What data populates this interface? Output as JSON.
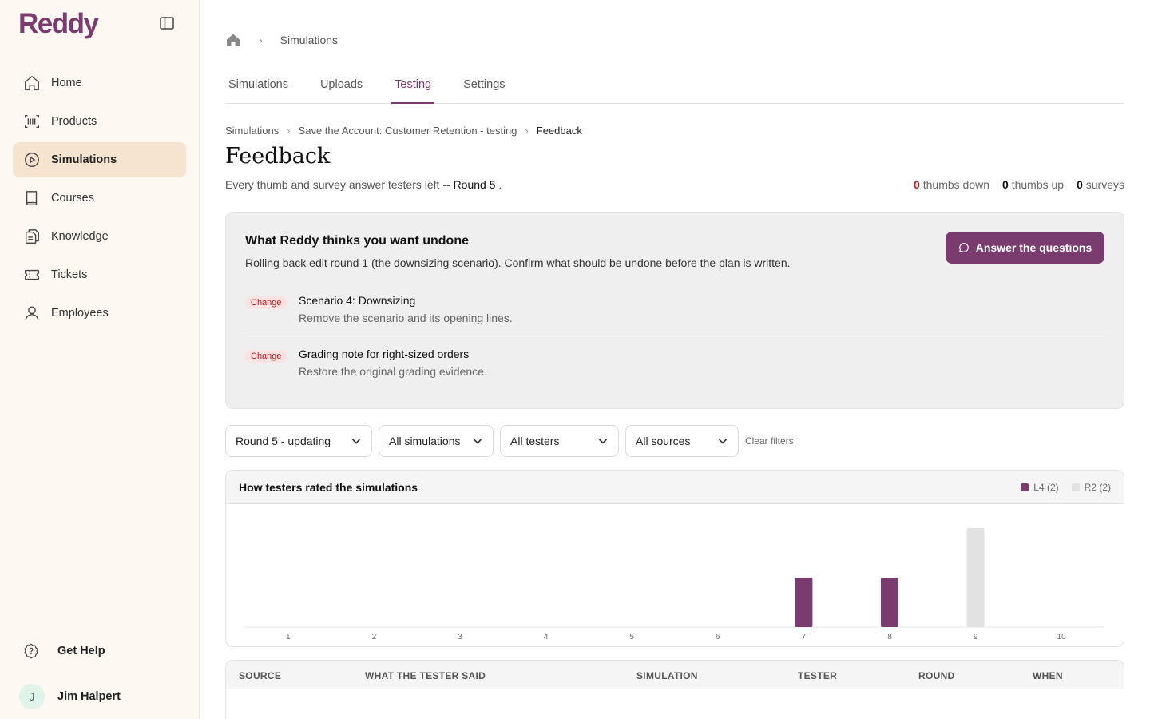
{
  "app": {
    "logo": "Reddy"
  },
  "sidebar": {
    "items": [
      {
        "label": "Home",
        "icon": "home-icon"
      },
      {
        "label": "Products",
        "icon": "barcode-icon"
      },
      {
        "label": "Simulations",
        "icon": "play-circle-icon",
        "active": true
      },
      {
        "label": "Courses",
        "icon": "book-icon"
      },
      {
        "label": "Knowledge",
        "icon": "documents-icon"
      },
      {
        "label": "Tickets",
        "icon": "ticket-icon"
      },
      {
        "label": "Employees",
        "icon": "user-icon"
      }
    ],
    "help_label": "Get Help",
    "user": {
      "initial": "J",
      "name": "Jim Halpert"
    }
  },
  "topcrumb": {
    "current": "Simulations"
  },
  "tabs": [
    {
      "label": "Simulations"
    },
    {
      "label": "Uploads"
    },
    {
      "label": "Testing",
      "active": true
    },
    {
      "label": "Settings"
    }
  ],
  "breadcrumb": {
    "items": [
      "Simulations",
      "Save the Account: Customer Retention - testing"
    ],
    "current": "Feedback"
  },
  "page": {
    "title": "Feedback",
    "subtitle_prefix": "Every thumb and survey answer testers left -- ",
    "subtitle_round": "Round 5",
    "subtitle_suffix": " .",
    "stats": {
      "thumbs_down_count": "0",
      "thumbs_down_label": " thumbs down",
      "thumbs_up_count": "0",
      "thumbs_up_label": " thumbs up",
      "surveys_count": "0",
      "surveys_label": " surveys"
    }
  },
  "undo_panel": {
    "title": "What Reddy thinks you want undone",
    "description": "Rolling back edit round 1 (the downsizing scenario). Confirm what should be undone before the plan is written.",
    "button_label": "Answer the questions",
    "changes": [
      {
        "badge": "Change",
        "title": "Scenario 4: Downsizing",
        "detail": "Remove the scenario and its opening lines."
      },
      {
        "badge": "Change",
        "title": "Grading note for right-sized orders",
        "detail": "Restore the original grading evidence."
      }
    ]
  },
  "filters": {
    "round": "Round 5 - updating",
    "simulation": "All simulations",
    "tester": "All testers",
    "source": "All sources",
    "clear_label": "Clear filters"
  },
  "chart_data": {
    "type": "bar",
    "title": "How testers rated the simulations",
    "categories": [
      "1",
      "2",
      "3",
      "4",
      "5",
      "6",
      "7",
      "8",
      "9",
      "10"
    ],
    "series": [
      {
        "name": "L4 (2)",
        "color": "#7a3b6e",
        "values": [
          0,
          0,
          0,
          0,
          0,
          0,
          1,
          1,
          0,
          0
        ]
      },
      {
        "name": "R2 (2)",
        "color": "#e2e2e2",
        "values": [
          0,
          0,
          0,
          0,
          0,
          0,
          0,
          0,
          2,
          0
        ]
      }
    ],
    "ylim": [
      0,
      2
    ],
    "grid": false,
    "legend": "top-right"
  },
  "table": {
    "headers": [
      "SOURCE",
      "WHAT THE TESTER SAID",
      "SIMULATION",
      "TESTER",
      "ROUND",
      "WHEN"
    ]
  }
}
